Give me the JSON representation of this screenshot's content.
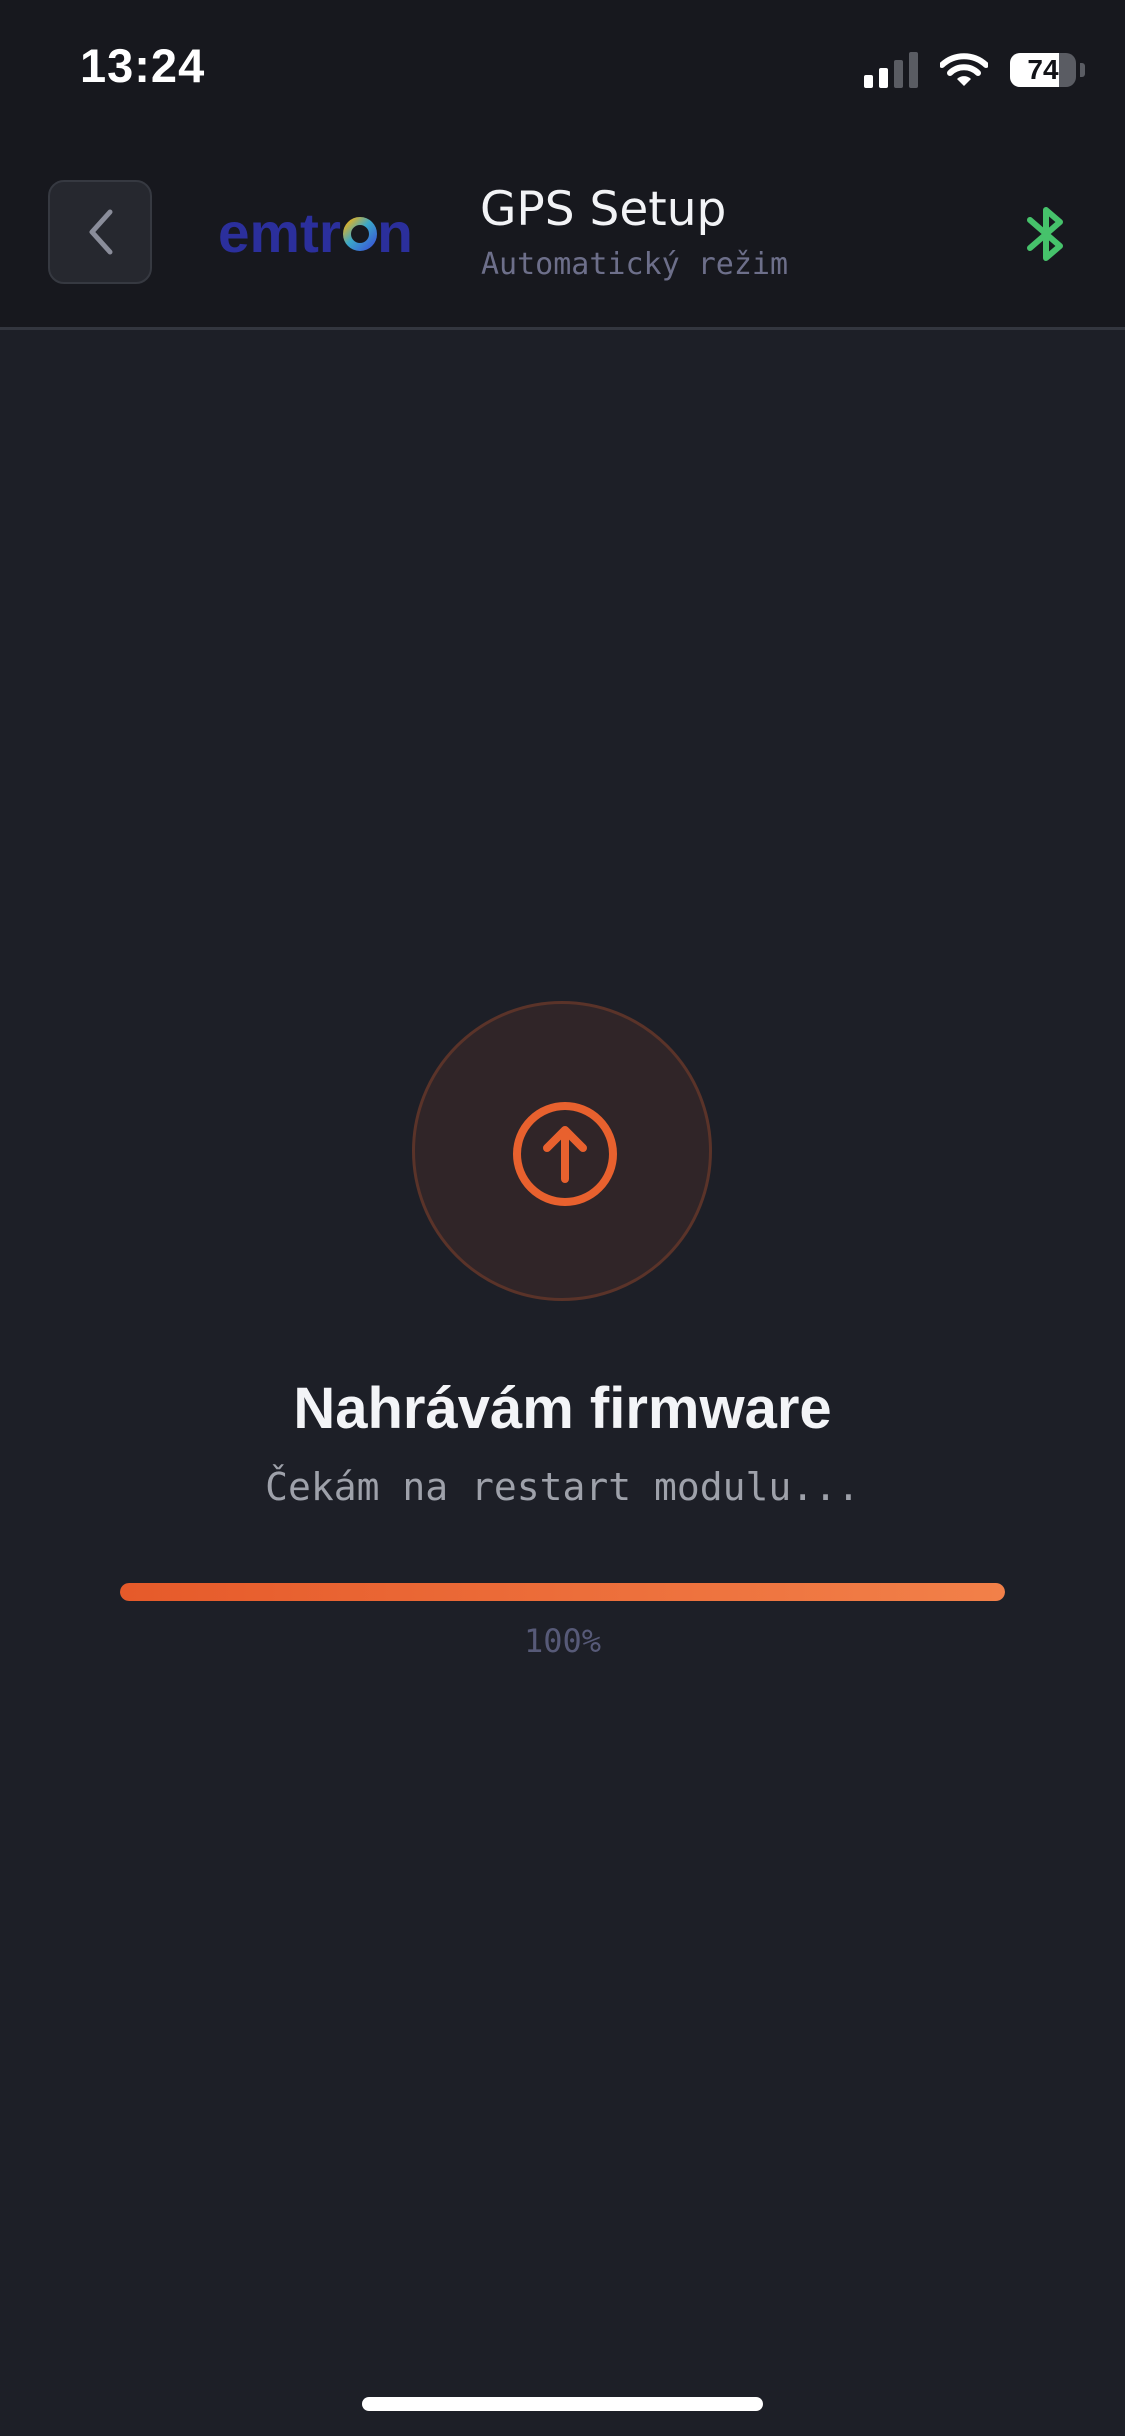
{
  "status_bar": {
    "time": "13:24",
    "battery_level": "74",
    "battery_fraction": 0.74,
    "signal_bars_active": 2,
    "signal_bars_total": 4
  },
  "header": {
    "title": "GPS Setup",
    "subtitle": "Automatický režim",
    "logo_text": "emtron",
    "bluetooth_color": "#46c26b"
  },
  "upload": {
    "heading": "Nahrávám firmware",
    "status": "Čekám na restart modulu...",
    "progress_percent": 100,
    "progress_label": "100%"
  },
  "colors": {
    "accent": "#e8612e",
    "logo_blue": "#2b2f9c",
    "background": "#1d1f27"
  }
}
